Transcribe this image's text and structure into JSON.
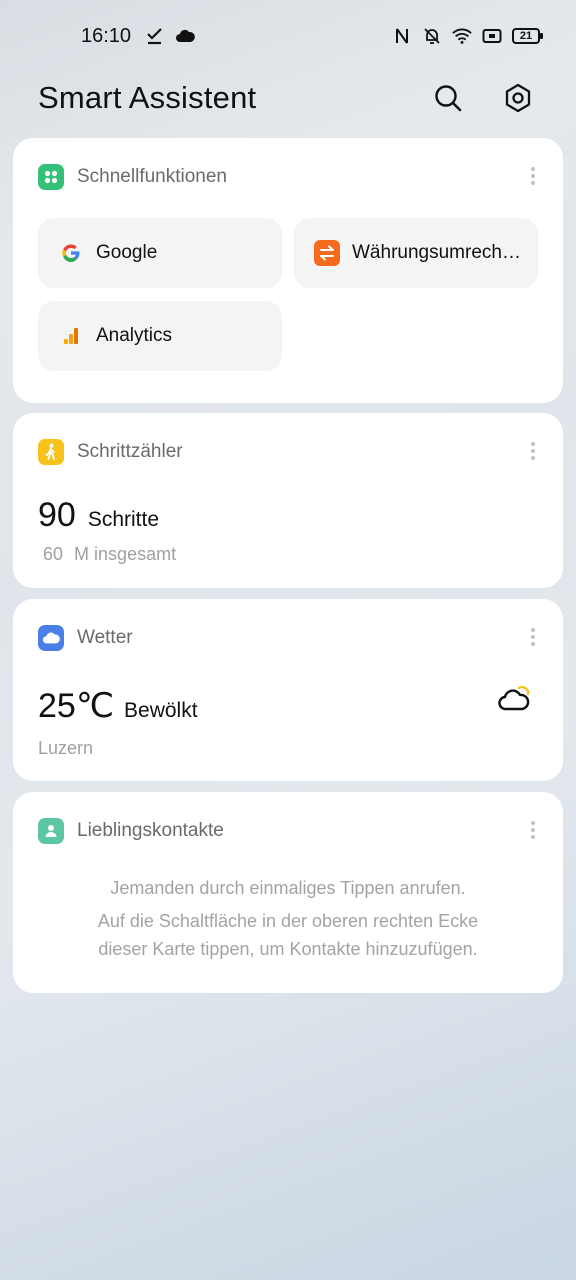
{
  "status_bar": {
    "time": "16:10",
    "battery": "21",
    "icons": [
      "check-download-icon",
      "cloud-icon",
      "nfc-icon",
      "bell-off-icon",
      "wifi-icon",
      "cast-icon",
      "battery-icon"
    ]
  },
  "header": {
    "title": "Smart Assistent"
  },
  "quick_functions": {
    "title": "Schnellfunktionen",
    "items": [
      {
        "label": "Google",
        "icon": "google-icon"
      },
      {
        "label": "Währungsumrechner",
        "icon": "currency-convert-icon"
      },
      {
        "label": "Analytics",
        "icon": "analytics-icon"
      }
    ]
  },
  "pedometer": {
    "title": "Schrittzähler",
    "steps": "90",
    "steps_label": "Schritte",
    "distance_value": "60",
    "distance_label": "M insgesamt"
  },
  "weather": {
    "title": "Wetter",
    "temperature": "25℃",
    "condition": "Bewölkt",
    "location": "Luzern"
  },
  "favorite_contacts": {
    "title": "Lieblingskontakte",
    "line1": "Jemanden durch einmaliges Tippen anrufen.",
    "line2": "Auf die Schaltfläche in der oberen rechten Ecke",
    "line3": "dieser Karte tippen, um Kontakte hinzuzufügen."
  },
  "colors": {
    "quick_icon": "#35c07a",
    "pedometer_icon": "#f7c21b",
    "weather_icon": "#4a7fe8",
    "contacts_icon": "#5cc7a2",
    "currency_icon": "#f56a1c",
    "analytics_icon": "#f2a11b"
  }
}
